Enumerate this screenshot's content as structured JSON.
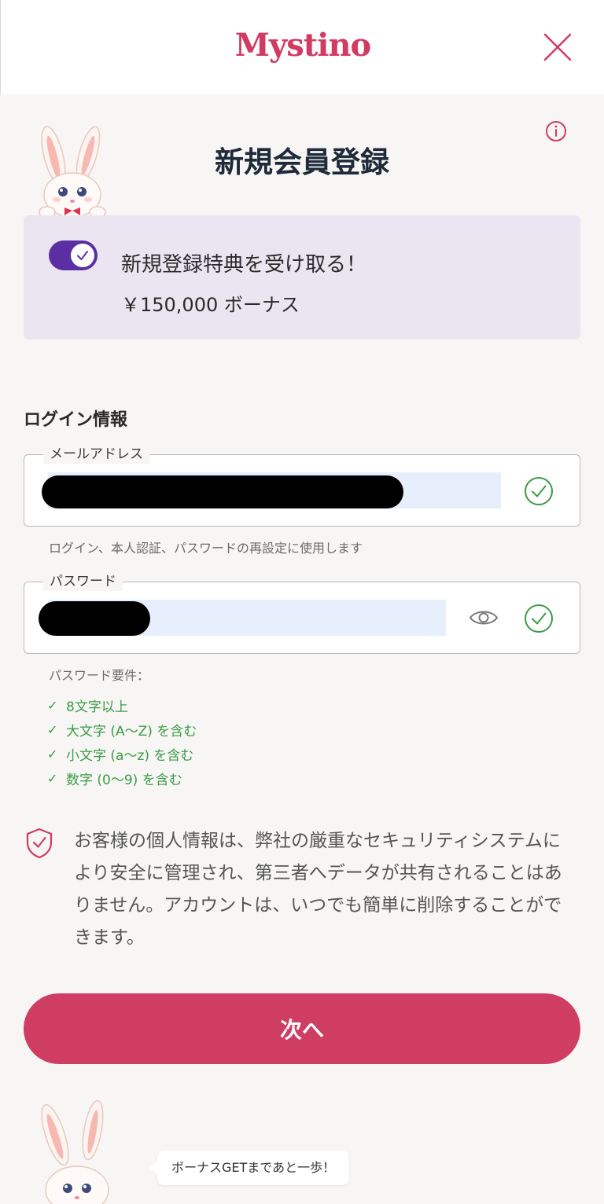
{
  "header": {
    "logo_text": "Mystino",
    "close_icon": "close-icon"
  },
  "title": "新規会員登録",
  "info_icon": "info-icon",
  "bonus": {
    "enabled": true,
    "title": "新規登録特典を受け取る！",
    "amount": "￥150,000 ボーナス"
  },
  "login_section": {
    "label": "ログイン情報",
    "email": {
      "legend": "メールアドレス",
      "value": "",
      "hint": "ログイン、本人認証、パスワードの再設定に使用します"
    },
    "password": {
      "legend": "パスワード",
      "value": ""
    },
    "requirements": {
      "title": "パスワード要件：",
      "items": [
        "8文字以上",
        "大文字 (A〜Z) を含む",
        "小文字 (a〜z) を含む",
        "数字 (0〜9) を含む"
      ]
    }
  },
  "privacy_text": "お客様の個人情報は、弊社の厳重なセキュリティシステムにより安全に管理され、第三者へデータが共有されることはありません。アカウントは、いつでも簡単に削除することができます。",
  "next_button": "次へ",
  "bubble_text": "ボーナスGETまであと一歩！",
  "colors": {
    "brand": "#cf3d63",
    "toggle": "#5b2fa3",
    "success": "#3a9c46",
    "bonus_card": "#ebe5f1"
  }
}
